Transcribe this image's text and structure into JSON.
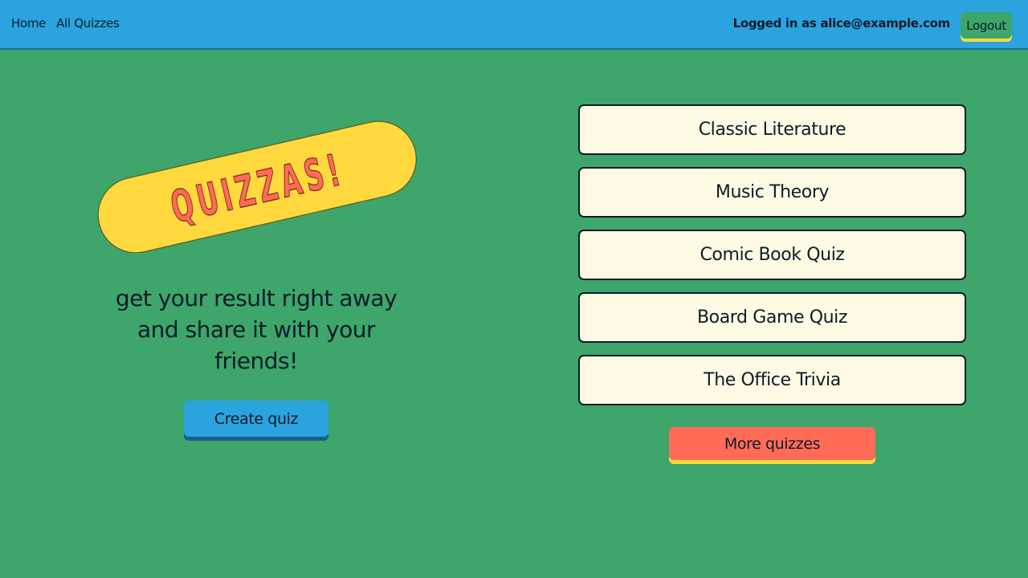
{
  "nav": {
    "links": [
      {
        "label": "Home"
      },
      {
        "label": "All Quizzes"
      }
    ],
    "user_text": "Logged in as alice@example.com",
    "logout_label": "Logout"
  },
  "hero": {
    "banner_text": "QUIZZAS!",
    "tagline": "get your result right away and share it with your friends!",
    "create_label": "Create quiz"
  },
  "quizzes": [
    {
      "title": "Classic Literature"
    },
    {
      "title": "Music Theory"
    },
    {
      "title": "Comic Book Quiz"
    },
    {
      "title": "Board Game Quiz"
    },
    {
      "title": "The Office Trivia"
    }
  ],
  "more_label": "More quizzes",
  "colors": {
    "background": "#3ea66a",
    "navbar": "#2ba3df",
    "banner_fill": "#ffd93d",
    "banner_text": "#ff6b57",
    "card": "#fffae3",
    "accent_red": "#ff6b57"
  }
}
